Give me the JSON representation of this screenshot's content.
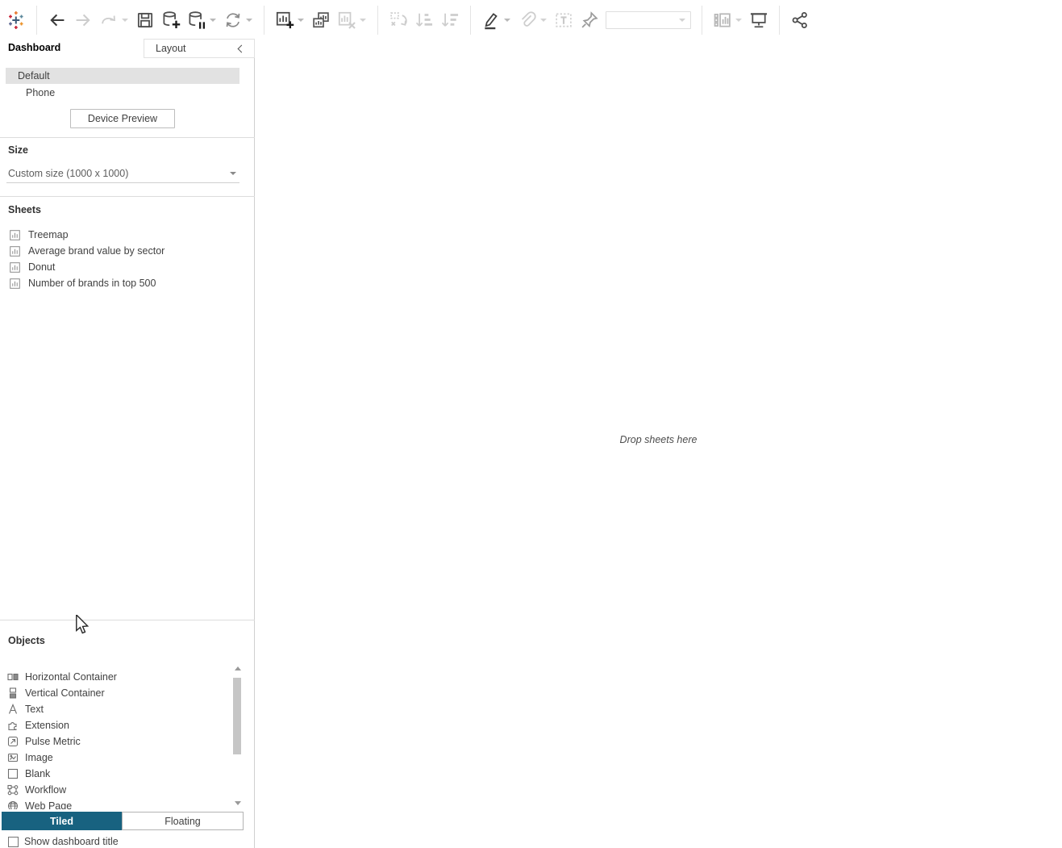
{
  "toolbar": {
    "icons": [
      "tableau-logo",
      "back",
      "forward",
      "redo",
      "save",
      "add-data-source",
      "pause-auto-updates",
      "refresh-data-source",
      "new-worksheet",
      "duplicate-sheet",
      "clear-sheet",
      "swap-rows-and-columns",
      "sort-ascending",
      "sort-descending",
      "highlight",
      "group-members",
      "show-mark-labels",
      "fix-axes",
      "fit-selector",
      "show-hide-cards",
      "presentation-mode",
      "share-workbook"
    ],
    "fit_selector_value": ""
  },
  "panel": {
    "tabs": {
      "dashboard": "Dashboard",
      "layout": "Layout"
    },
    "devices": {
      "items": [
        {
          "label": "Default",
          "selected": true
        },
        {
          "label": "Phone",
          "selected": false
        }
      ]
    },
    "device_preview_label": "Device Preview",
    "size": {
      "label": "Size",
      "value": "Custom size (1000 x 1000)"
    },
    "sheets": {
      "label": "Sheets",
      "items": [
        "Treemap",
        "Average brand value by sector",
        "Donut",
        "Number of brands in top 500"
      ]
    },
    "objects": {
      "label": "Objects",
      "items": [
        {
          "icon": "horizontal-container-icon",
          "label": "Horizontal Container"
        },
        {
          "icon": "vertical-container-icon",
          "label": "Vertical Container"
        },
        {
          "icon": "text-icon",
          "label": "Text"
        },
        {
          "icon": "extension-icon",
          "label": "Extension"
        },
        {
          "icon": "pulse-metric-icon",
          "label": "Pulse Metric"
        },
        {
          "icon": "image-icon",
          "label": "Image"
        },
        {
          "icon": "blank-icon",
          "label": "Blank"
        },
        {
          "icon": "workflow-icon",
          "label": "Workflow"
        },
        {
          "icon": "web-page-icon",
          "label": "Web Page"
        }
      ]
    },
    "mode": {
      "tiled_label": "Tiled",
      "floating_label": "Floating",
      "selected": "Tiled"
    },
    "show_title": {
      "label": "Show dashboard title",
      "checked": false
    }
  },
  "canvas": {
    "placeholder": "Drop sheets here"
  },
  "colors": {
    "accent_tiled": "#186280",
    "selected_row_bg": "#e2e2e2",
    "panel_border": "#cfcfcf"
  }
}
